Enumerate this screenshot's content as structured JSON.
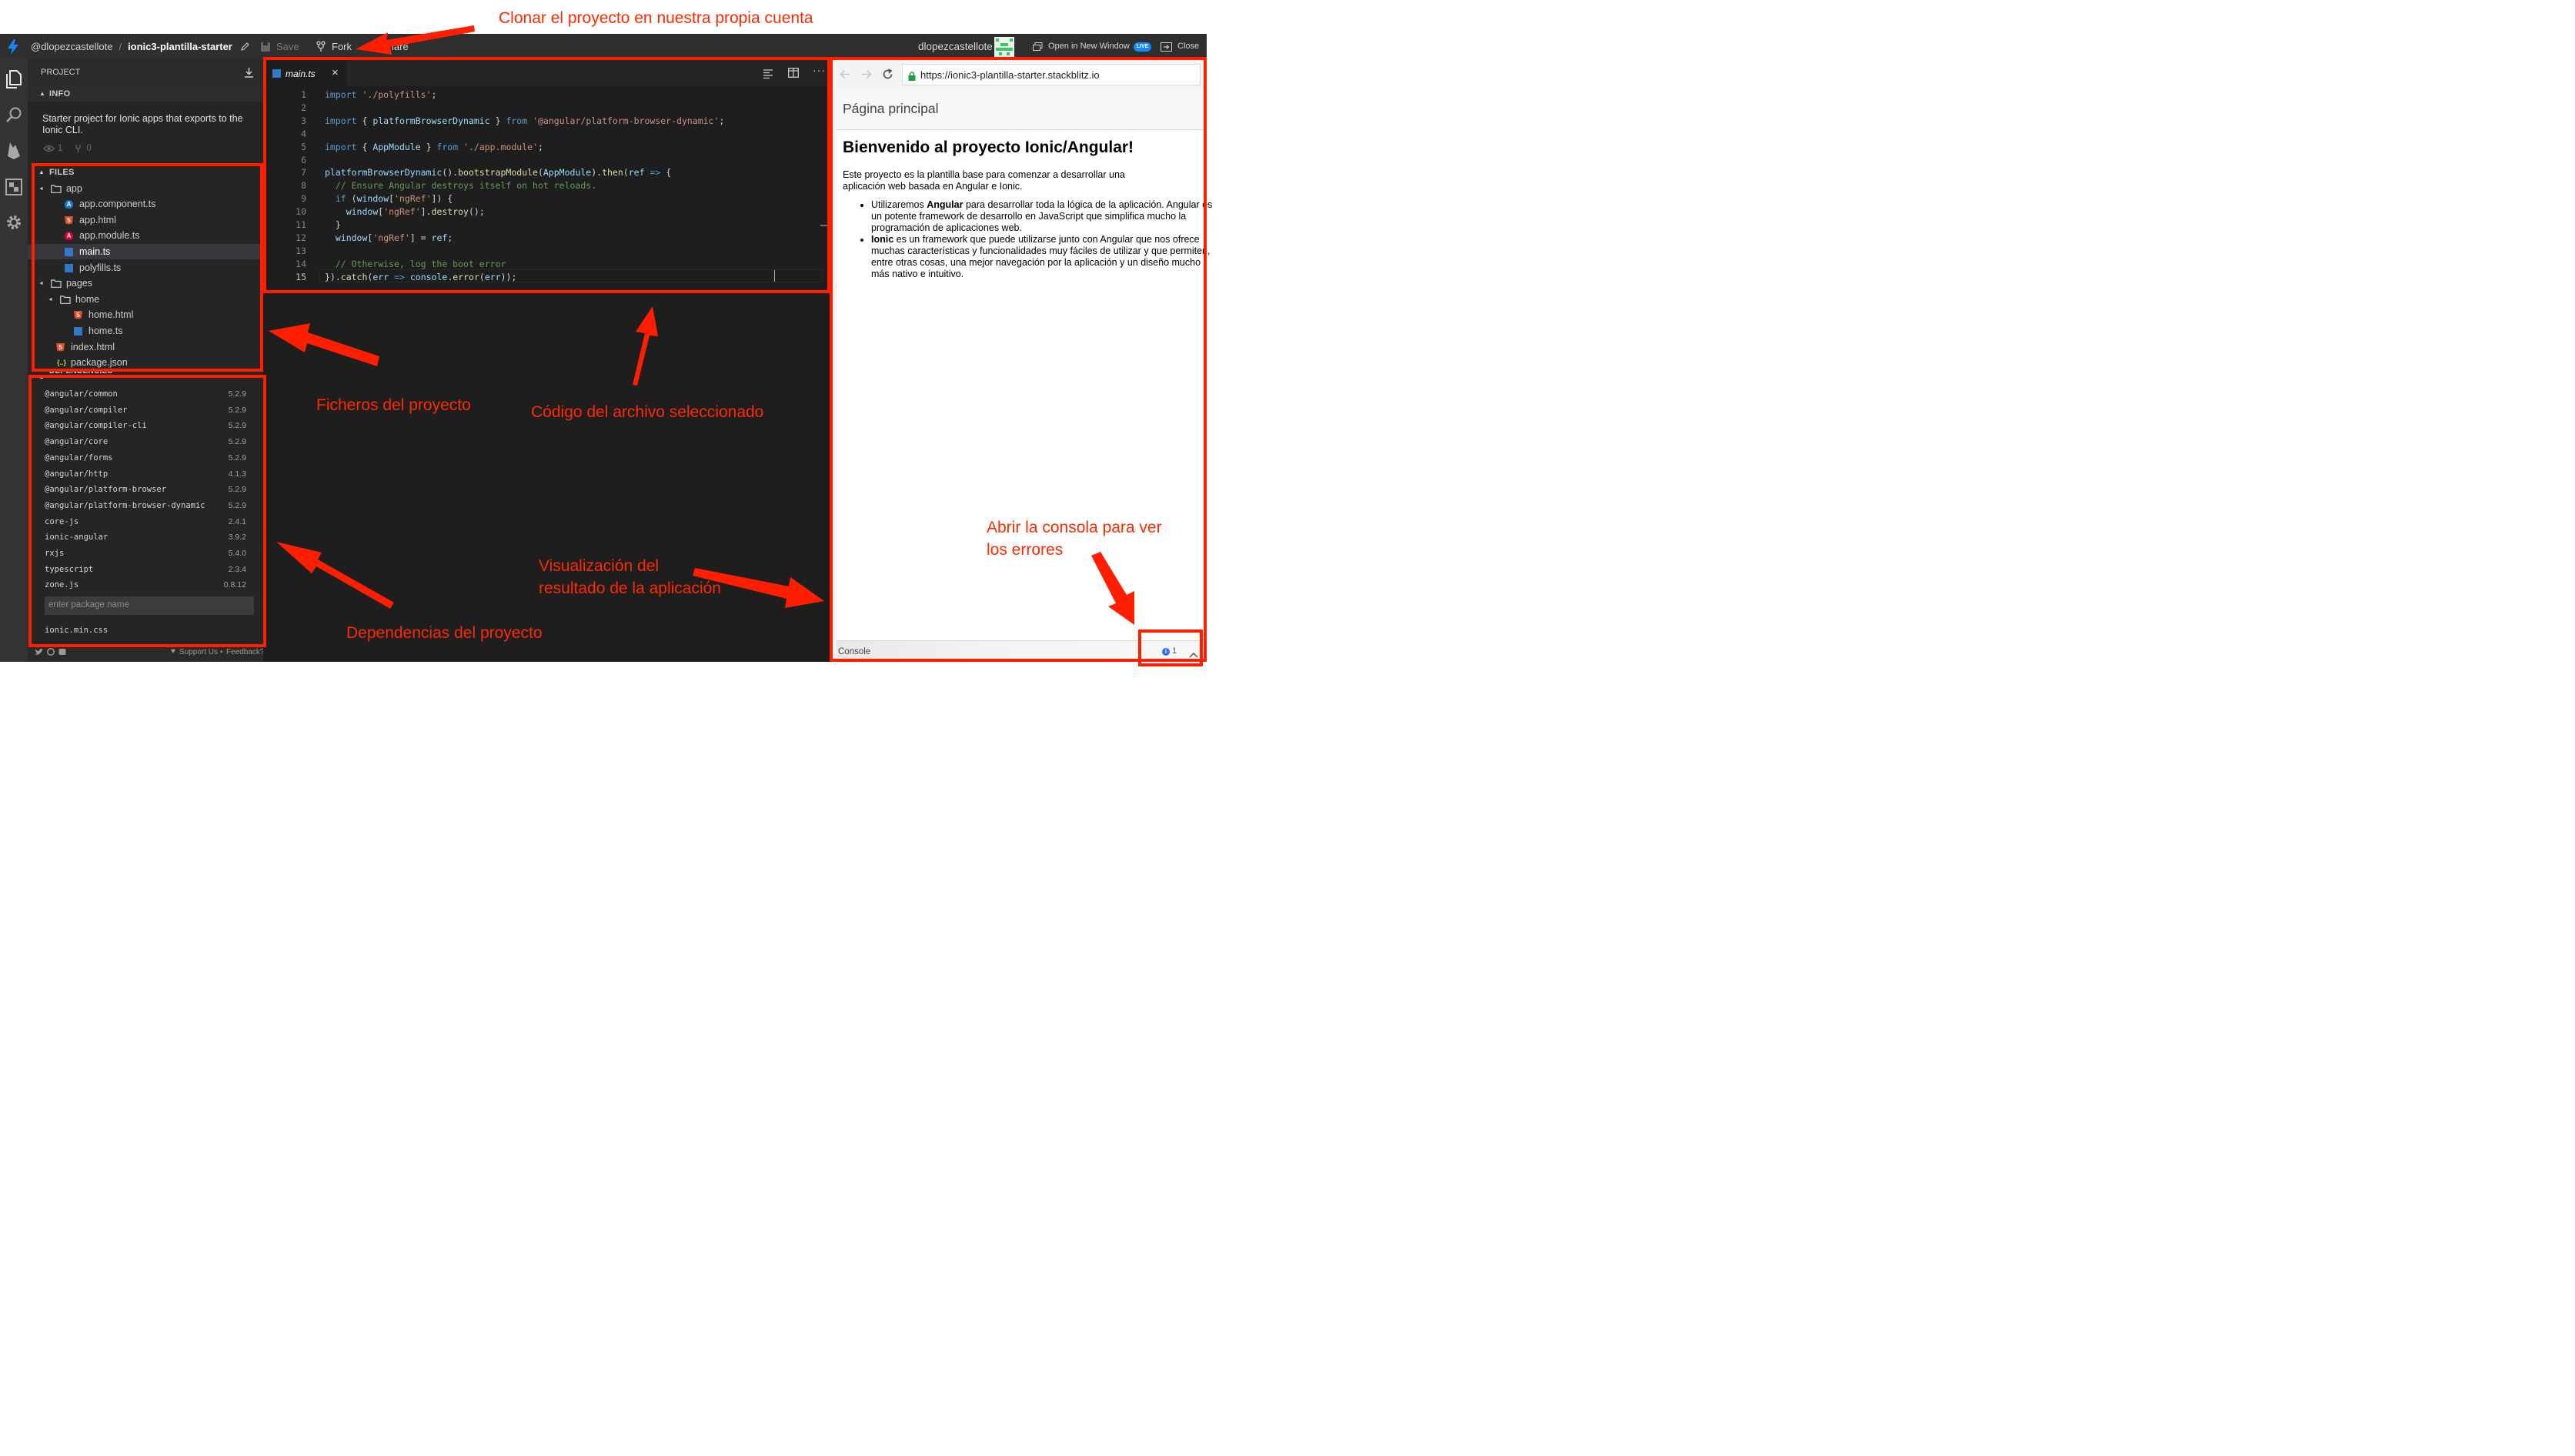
{
  "annotations": {
    "clone": "Clonar el proyecto en nuestra propia cuenta",
    "files": "Ficheros del proyecto",
    "code": "Código del archivo seleccionado",
    "preview_line1": "Visualización del",
    "preview_line2": "resultado de la aplicación",
    "console_line1": "Abrir la consola para ver",
    "console_line2": "los errores",
    "deps": "Dependencias del proyecto"
  },
  "topbar": {
    "owner": "@dlopezcastellote",
    "separator": "/",
    "project": "ionic3-plantilla-starter",
    "save": "Save",
    "fork": "Fork",
    "share": "Share",
    "username": "dlopezcastellote",
    "open_new_window": "Open in New Window",
    "live_badge": "LIVE",
    "close": "Close"
  },
  "sidebar": {
    "project_header": "PROJECT",
    "info_header": "INFO",
    "description": "Starter project for Ionic apps that exports to the Ionic CLI.",
    "views": "1",
    "forks": "0",
    "files_header": "FILES",
    "files": [
      {
        "label": "app",
        "type": "folder"
      },
      {
        "label": "app.component.ts",
        "type": "angular-blue"
      },
      {
        "label": "app.html",
        "type": "html"
      },
      {
        "label": "app.module.ts",
        "type": "angular-red"
      },
      {
        "label": "main.ts",
        "type": "ts"
      },
      {
        "label": "polyfills.ts",
        "type": "ts"
      },
      {
        "label": "pages",
        "type": "folder"
      },
      {
        "label": "home",
        "type": "folder"
      },
      {
        "label": "home.html",
        "type": "html"
      },
      {
        "label": "home.ts",
        "type": "ts"
      },
      {
        "label": "index.html",
        "type": "html"
      },
      {
        "label": "package.json",
        "type": "json"
      }
    ],
    "deps_header": "DEPENDENCIES",
    "dependencies": [
      {
        "name": "@angular/common",
        "version": "5.2.9"
      },
      {
        "name": "@angular/compiler",
        "version": "5.2.9"
      },
      {
        "name": "@angular/compiler-cli",
        "version": "5.2.9"
      },
      {
        "name": "@angular/core",
        "version": "5.2.9"
      },
      {
        "name": "@angular/forms",
        "version": "5.2.9"
      },
      {
        "name": "@angular/http",
        "version": "4.1.3"
      },
      {
        "name": "@angular/platform-browser",
        "version": "5.2.9"
      },
      {
        "name": "@angular/platform-browser-dynamic",
        "version": "5.2.9"
      },
      {
        "name": "core-js",
        "version": "2.4.1"
      },
      {
        "name": "ionic-angular",
        "version": "3.9.2"
      },
      {
        "name": "rxjs",
        "version": "5.4.0"
      },
      {
        "name": "typescript",
        "version": "2.3.4"
      },
      {
        "name": "zone.js",
        "version": "0.8.12"
      }
    ],
    "package_placeholder": "enter package name",
    "external_css": "ionic.min.css",
    "support": "Support Us",
    "dot": "•",
    "feedback": "Feedback?"
  },
  "editor": {
    "tab_label": "main.ts",
    "tab_close": "×",
    "lines": [
      {
        "n": "1",
        "code": "import './polyfills';"
      },
      {
        "n": "2",
        "code": ""
      },
      {
        "n": "3",
        "code": "import { platformBrowserDynamic } from '@angular/platform-browser-dynamic';"
      },
      {
        "n": "4",
        "code": ""
      },
      {
        "n": "5",
        "code": "import { AppModule } from './app.module';"
      },
      {
        "n": "6",
        "code": ""
      },
      {
        "n": "7",
        "code": "platformBrowserDynamic().bootstrapModule(AppModule).then(ref => {"
      },
      {
        "n": "8",
        "code": "  // Ensure Angular destroys itself on hot reloads."
      },
      {
        "n": "9",
        "code": "  if (window['ngRef']) {"
      },
      {
        "n": "10",
        "code": "    window['ngRef'].destroy();"
      },
      {
        "n": "11",
        "code": "  }"
      },
      {
        "n": "12",
        "code": "  window['ngRef'] = ref;"
      },
      {
        "n": "13",
        "code": ""
      },
      {
        "n": "14",
        "code": "  // Otherwise, log the boot error"
      },
      {
        "n": "15",
        "code": "}).catch(err => console.error(err));"
      }
    ]
  },
  "preview": {
    "url": "https://ionic3-plantilla-starter.stackblitz.io",
    "page_title": "Página principal",
    "heading": "Bienvenido al proyecto Ionic/Angular!",
    "intro": "Este proyecto es la plantilla base para comenzar a desarrollar una aplicación web basada en Angular e Ionic.",
    "bullet1_pre": "Utilizaremos ",
    "bullet1_bold": "Angular",
    "bullet1_post": " para desarrollar toda la lógica de la aplicación. Angular es un potente framework de desarrollo en JavaScript que simplifica mucho la programación de aplicaciones web.",
    "bullet2_bold": "Ionic",
    "bullet2_post": " es un framework que puede utilizarse junto con Angular que nos ofrece muchas características y funcionalidades muy fáciles de utilizar y que permiten, entre otras cosas, una mejor navegación por la aplicación y un diseño mucho más nativo e intuitivo.",
    "console_label": "Console",
    "console_count": "1"
  },
  "colors": {
    "annotation_red": "#ff2a00",
    "accent_blue": "#1389fd",
    "html_orange": "#e44d26",
    "angular_red": "#dd0031",
    "ts_blue": "#3178c6"
  }
}
